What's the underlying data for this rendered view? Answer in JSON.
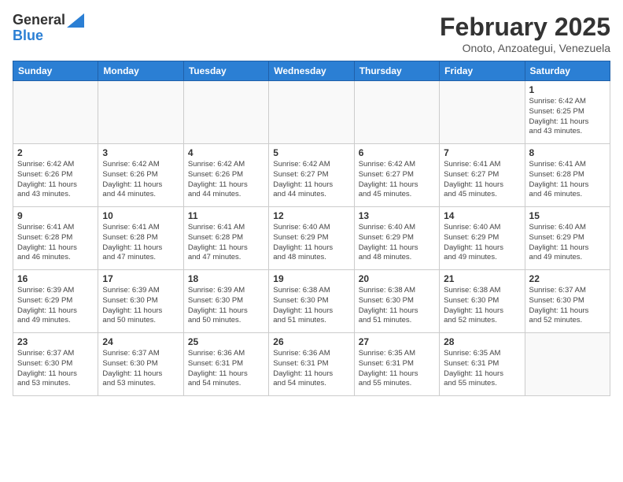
{
  "header": {
    "logo_line1": "General",
    "logo_line2": "Blue",
    "month_title": "February 2025",
    "location": "Onoto, Anzoategui, Venezuela"
  },
  "weekdays": [
    "Sunday",
    "Monday",
    "Tuesday",
    "Wednesday",
    "Thursday",
    "Friday",
    "Saturday"
  ],
  "weeks": [
    [
      {
        "day": "",
        "info": ""
      },
      {
        "day": "",
        "info": ""
      },
      {
        "day": "",
        "info": ""
      },
      {
        "day": "",
        "info": ""
      },
      {
        "day": "",
        "info": ""
      },
      {
        "day": "",
        "info": ""
      },
      {
        "day": "1",
        "info": "Sunrise: 6:42 AM\nSunset: 6:25 PM\nDaylight: 11 hours\nand 43 minutes."
      }
    ],
    [
      {
        "day": "2",
        "info": "Sunrise: 6:42 AM\nSunset: 6:26 PM\nDaylight: 11 hours\nand 43 minutes."
      },
      {
        "day": "3",
        "info": "Sunrise: 6:42 AM\nSunset: 6:26 PM\nDaylight: 11 hours\nand 44 minutes."
      },
      {
        "day": "4",
        "info": "Sunrise: 6:42 AM\nSunset: 6:26 PM\nDaylight: 11 hours\nand 44 minutes."
      },
      {
        "day": "5",
        "info": "Sunrise: 6:42 AM\nSunset: 6:27 PM\nDaylight: 11 hours\nand 44 minutes."
      },
      {
        "day": "6",
        "info": "Sunrise: 6:42 AM\nSunset: 6:27 PM\nDaylight: 11 hours\nand 45 minutes."
      },
      {
        "day": "7",
        "info": "Sunrise: 6:41 AM\nSunset: 6:27 PM\nDaylight: 11 hours\nand 45 minutes."
      },
      {
        "day": "8",
        "info": "Sunrise: 6:41 AM\nSunset: 6:28 PM\nDaylight: 11 hours\nand 46 minutes."
      }
    ],
    [
      {
        "day": "9",
        "info": "Sunrise: 6:41 AM\nSunset: 6:28 PM\nDaylight: 11 hours\nand 46 minutes."
      },
      {
        "day": "10",
        "info": "Sunrise: 6:41 AM\nSunset: 6:28 PM\nDaylight: 11 hours\nand 47 minutes."
      },
      {
        "day": "11",
        "info": "Sunrise: 6:41 AM\nSunset: 6:28 PM\nDaylight: 11 hours\nand 47 minutes."
      },
      {
        "day": "12",
        "info": "Sunrise: 6:40 AM\nSunset: 6:29 PM\nDaylight: 11 hours\nand 48 minutes."
      },
      {
        "day": "13",
        "info": "Sunrise: 6:40 AM\nSunset: 6:29 PM\nDaylight: 11 hours\nand 48 minutes."
      },
      {
        "day": "14",
        "info": "Sunrise: 6:40 AM\nSunset: 6:29 PM\nDaylight: 11 hours\nand 49 minutes."
      },
      {
        "day": "15",
        "info": "Sunrise: 6:40 AM\nSunset: 6:29 PM\nDaylight: 11 hours\nand 49 minutes."
      }
    ],
    [
      {
        "day": "16",
        "info": "Sunrise: 6:39 AM\nSunset: 6:29 PM\nDaylight: 11 hours\nand 49 minutes."
      },
      {
        "day": "17",
        "info": "Sunrise: 6:39 AM\nSunset: 6:30 PM\nDaylight: 11 hours\nand 50 minutes."
      },
      {
        "day": "18",
        "info": "Sunrise: 6:39 AM\nSunset: 6:30 PM\nDaylight: 11 hours\nand 50 minutes."
      },
      {
        "day": "19",
        "info": "Sunrise: 6:38 AM\nSunset: 6:30 PM\nDaylight: 11 hours\nand 51 minutes."
      },
      {
        "day": "20",
        "info": "Sunrise: 6:38 AM\nSunset: 6:30 PM\nDaylight: 11 hours\nand 51 minutes."
      },
      {
        "day": "21",
        "info": "Sunrise: 6:38 AM\nSunset: 6:30 PM\nDaylight: 11 hours\nand 52 minutes."
      },
      {
        "day": "22",
        "info": "Sunrise: 6:37 AM\nSunset: 6:30 PM\nDaylight: 11 hours\nand 52 minutes."
      }
    ],
    [
      {
        "day": "23",
        "info": "Sunrise: 6:37 AM\nSunset: 6:30 PM\nDaylight: 11 hours\nand 53 minutes."
      },
      {
        "day": "24",
        "info": "Sunrise: 6:37 AM\nSunset: 6:30 PM\nDaylight: 11 hours\nand 53 minutes."
      },
      {
        "day": "25",
        "info": "Sunrise: 6:36 AM\nSunset: 6:31 PM\nDaylight: 11 hours\nand 54 minutes."
      },
      {
        "day": "26",
        "info": "Sunrise: 6:36 AM\nSunset: 6:31 PM\nDaylight: 11 hours\nand 54 minutes."
      },
      {
        "day": "27",
        "info": "Sunrise: 6:35 AM\nSunset: 6:31 PM\nDaylight: 11 hours\nand 55 minutes."
      },
      {
        "day": "28",
        "info": "Sunrise: 6:35 AM\nSunset: 6:31 PM\nDaylight: 11 hours\nand 55 minutes."
      },
      {
        "day": "",
        "info": ""
      }
    ]
  ]
}
